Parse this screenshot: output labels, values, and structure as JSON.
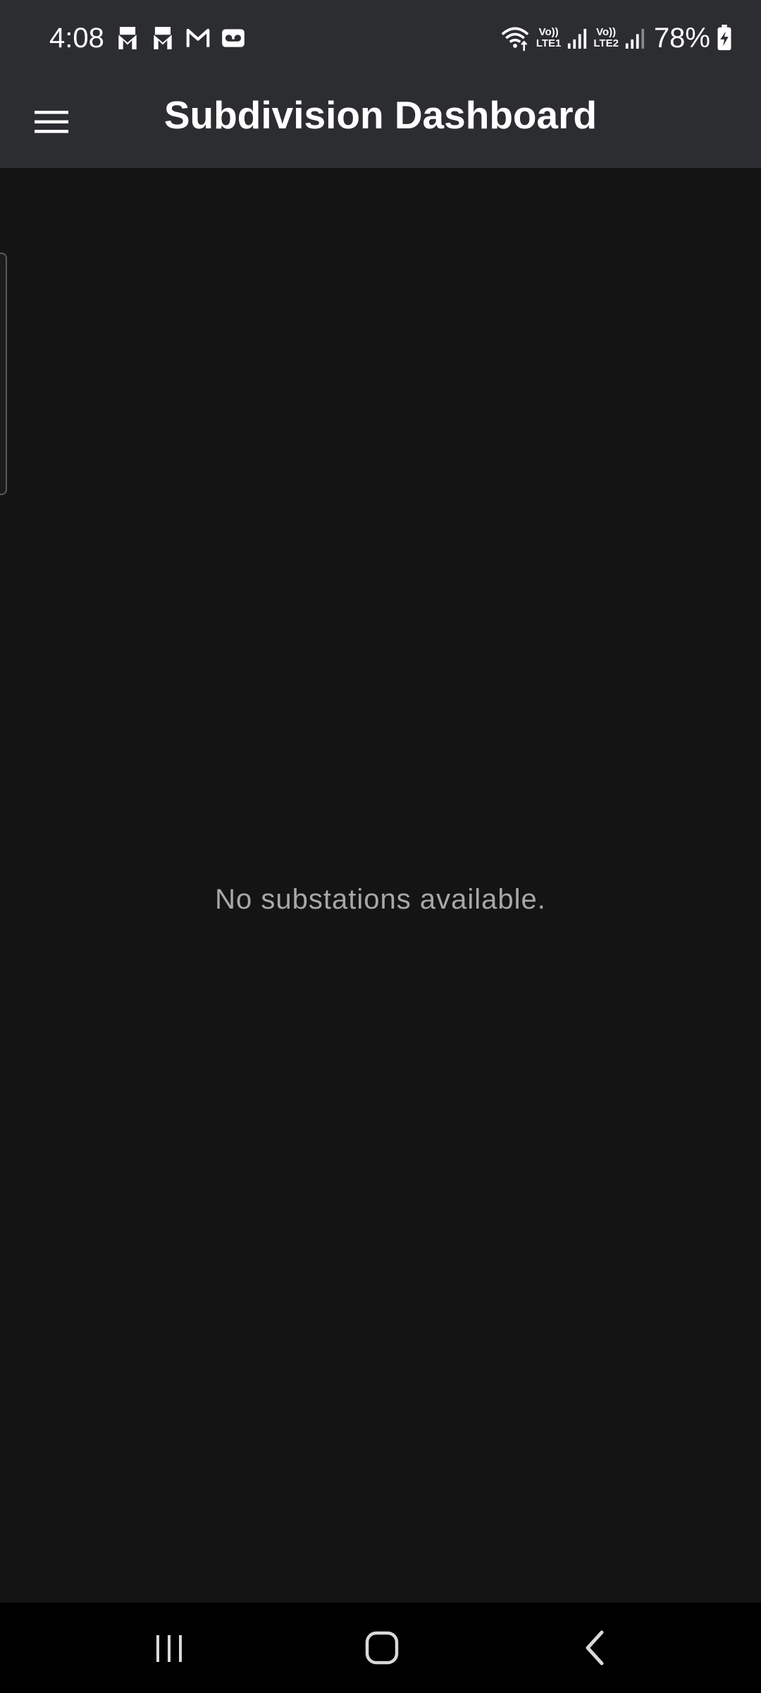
{
  "status_bar": {
    "time": "4:08",
    "left_icons": [
      "gmail-alt-icon",
      "gmail-alt-icon",
      "gmail-icon",
      "voicemail-icon"
    ],
    "sim1_top": "Vo))",
    "sim1_bottom": "LTE1",
    "sim2_top": "Vo))",
    "sim2_bottom": "LTE2",
    "battery": "78%"
  },
  "app_bar": {
    "title": "Subdivision Dashboard",
    "menu_icon": "hamburger-menu-icon"
  },
  "main": {
    "empty_message": "No substations available."
  },
  "nav_bar": {
    "recents_icon": "recents-icon",
    "home_icon": "home-icon",
    "back_icon": "back-icon"
  },
  "colors": {
    "bar_background": "#2c2d31",
    "content_background": "#141414",
    "nav_background": "#000000",
    "title_text": "#ffffff",
    "empty_text": "#a8a8a8"
  }
}
